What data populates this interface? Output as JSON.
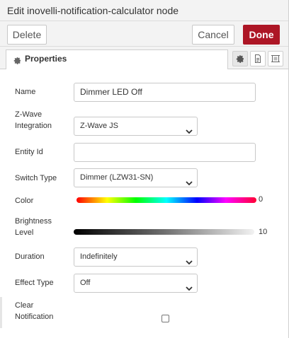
{
  "header": {
    "title": "Edit inovelli-notification-calculator node"
  },
  "toolbar": {
    "delete_label": "Delete",
    "cancel_label": "Cancel",
    "done_label": "Done"
  },
  "tabs": {
    "properties_label": "Properties"
  },
  "form": {
    "name": {
      "label": "Name",
      "value": "Dimmer LED Off"
    },
    "zwave": {
      "label_line1": "Z-Wave",
      "label_line2": "Integration",
      "value": "Z-Wave JS"
    },
    "entity_id": {
      "label": "Entity Id",
      "value": ""
    },
    "switch_type": {
      "label": "Switch Type",
      "value": "Dimmer (LZW31-SN)"
    },
    "color": {
      "label": "Color",
      "value": "0"
    },
    "brightness": {
      "label_line1": "Brightness",
      "label_line2": "Level",
      "value": "10"
    },
    "duration": {
      "label": "Duration",
      "value": "Indefinitely"
    },
    "effect_type": {
      "label": "Effect Type",
      "value": "Off"
    },
    "clear_notification": {
      "label_line1": "Clear",
      "label_line2": "Notification",
      "checked": false
    }
  },
  "colors": {
    "accent": "#ad1625",
    "panel_bg": "#f3f3f3",
    "border": "#c8c8c8"
  }
}
